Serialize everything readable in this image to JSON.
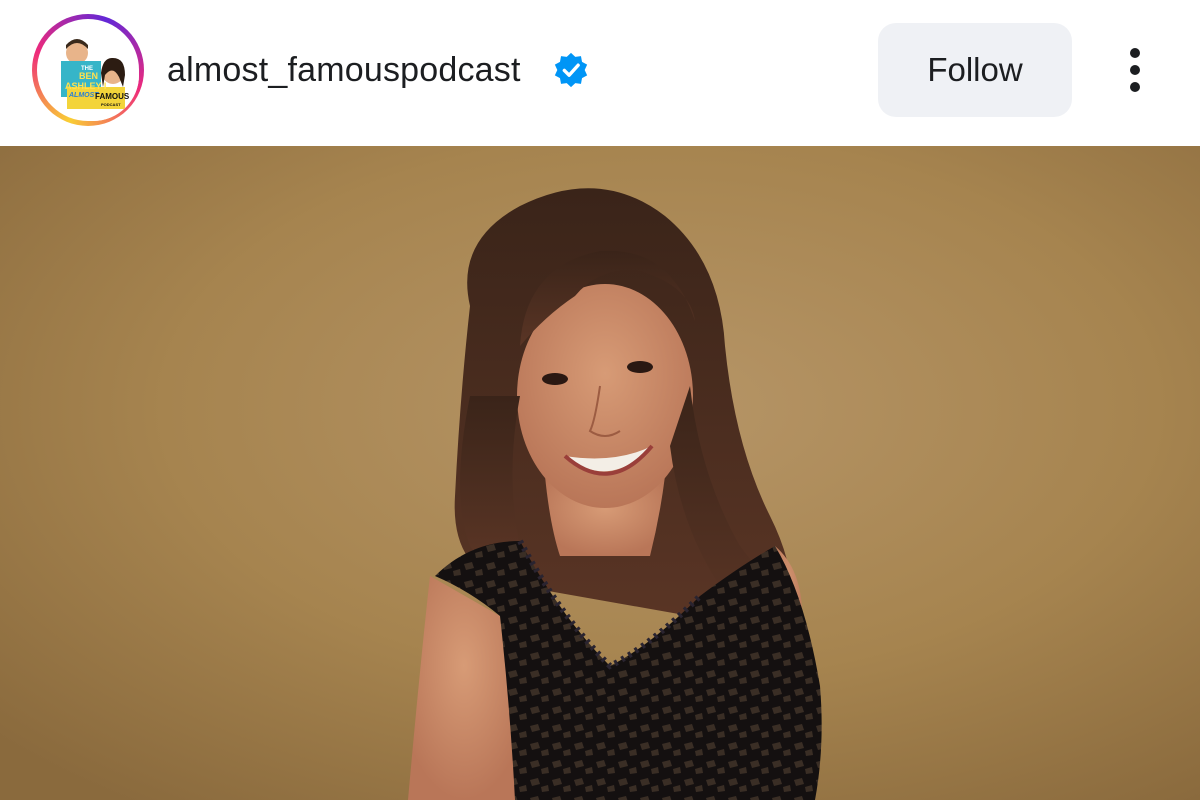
{
  "post": {
    "username": "almost_famouspodcast",
    "verified": true,
    "follow_label": "Follow",
    "more_icon": "more-vertical-icon",
    "avatar_icon": "podcast-logo-avatar",
    "avatar_logo_text": [
      "THE",
      "BEN",
      "&",
      "ASHLEY I",
      "ALMOST",
      "FAMOUS",
      "PODCAST"
    ]
  },
  "colors": {
    "ring_start": "#f9ce34",
    "ring_mid": "#ee2a7b",
    "verified_blue": "#0095f6",
    "follow_bg": "#eff1f5",
    "photo_background": "#a88755"
  },
  "photo": {
    "subject": "photo-portrait"
  }
}
